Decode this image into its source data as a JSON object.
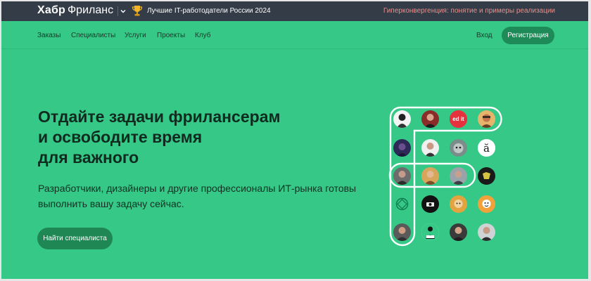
{
  "topbar": {
    "brand_primary": "Хабр",
    "brand_secondary": "Фриланс",
    "award_text": "Лучшие IT-работодатели России 2024",
    "promo_link": "Гиперконвергенция: понятие и примеры реализации"
  },
  "nav": {
    "items": [
      "Заказы",
      "Специалисты",
      "Услуги",
      "Проекты",
      "Клуб"
    ],
    "login": "Вход",
    "register": "Регистрация"
  },
  "hero": {
    "title_lines": [
      "Отдайте задачи фрилансерам",
      "и освободите время",
      "для важного"
    ],
    "subtitle_lines": [
      "Разработчики, дизайнеры и другие профессионалы ИТ-рынка готовы",
      "выполнить вашу задачу сейчас."
    ],
    "cta": "Найти специалиста"
  },
  "avatars": {
    "label_edit": "ed it",
    "label_a": "ă"
  },
  "colors": {
    "background": "#35c887",
    "topbar": "#333c47",
    "accent_button": "#1d8a58",
    "promo_link": "#e98f8b"
  }
}
